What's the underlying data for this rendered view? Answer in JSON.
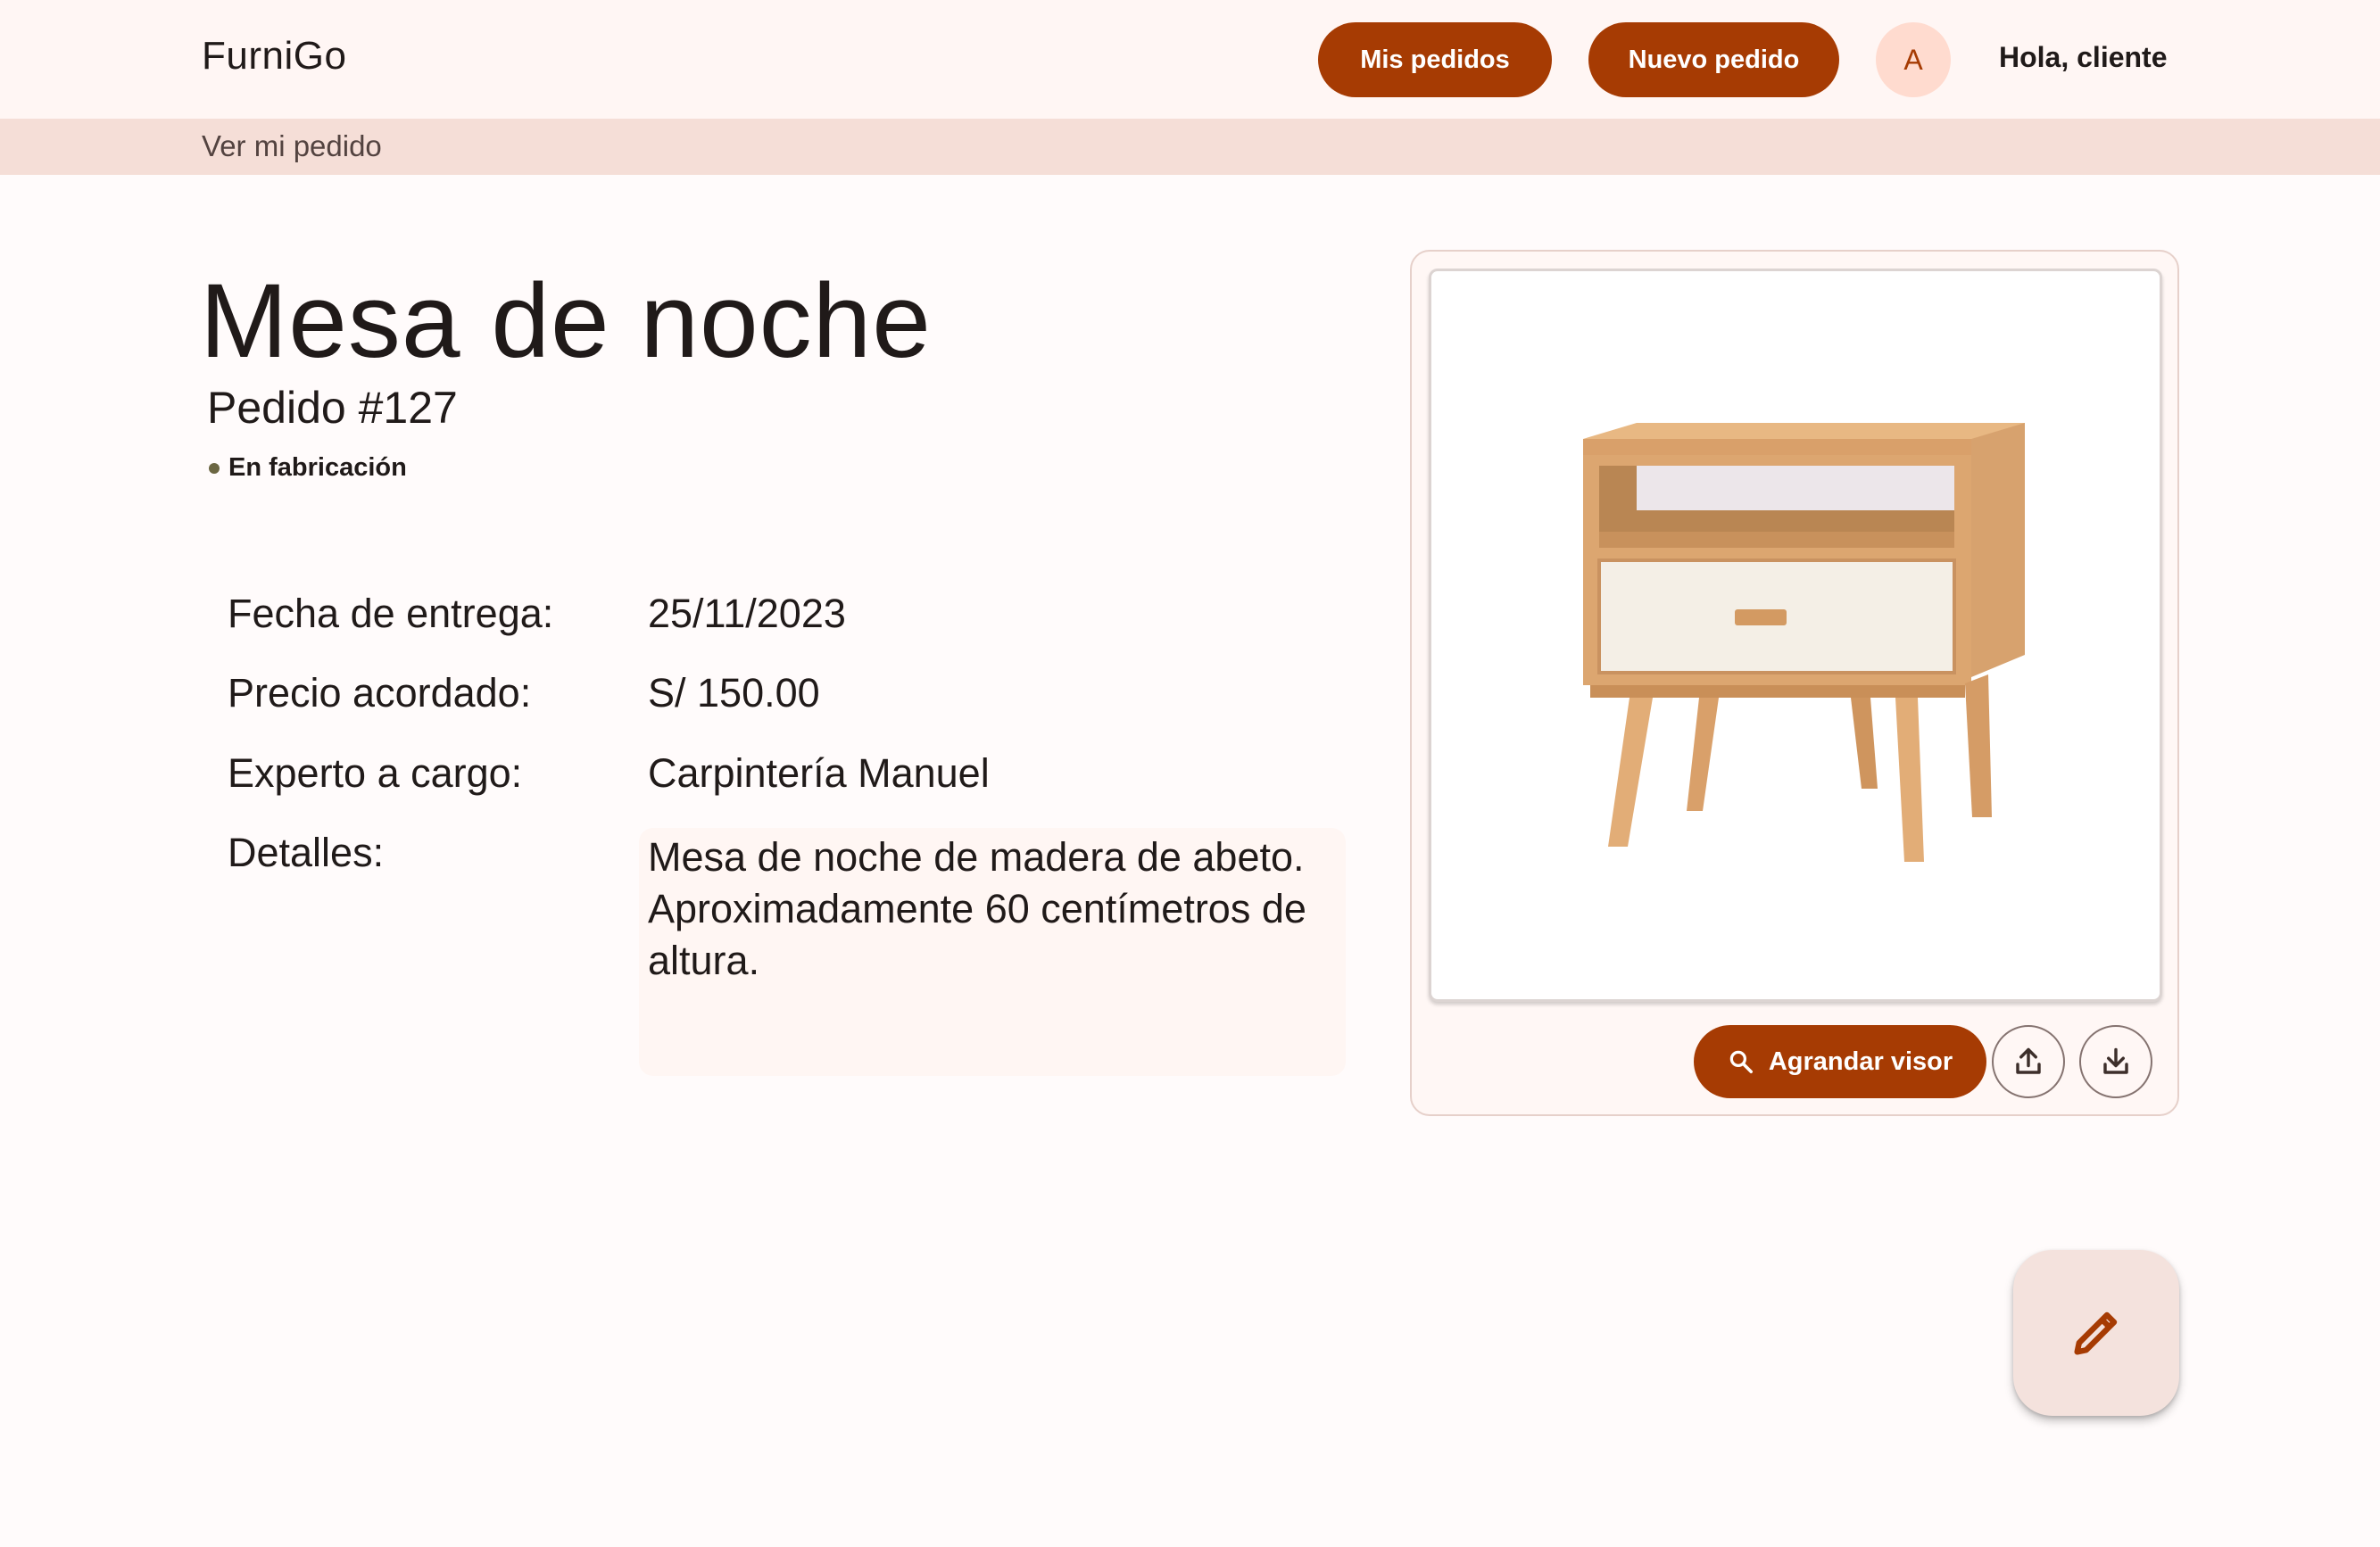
{
  "header": {
    "brand": "FurniGo",
    "nav": {
      "orders_label": "Mis pedidos",
      "new_order_label": "Nuevo pedido"
    },
    "avatar_initial": "A",
    "greeting": "Hola, cliente"
  },
  "breadcrumb": {
    "current": "Ver mi pedido"
  },
  "order": {
    "title": "Mesa de noche",
    "number": "Pedido #127",
    "status": "En fabricación",
    "details": {
      "delivery_label": "Fecha de entrega:",
      "delivery_value": "25/11/2023",
      "price_label": "Precio acordado:",
      "price_value": "S/ 150.00",
      "expert_label": "Experto a cargo:",
      "expert_value": "Carpintería Manuel",
      "notes_label": "Detalles:",
      "notes_value": "Mesa de noche de madera de abeto. Aproximadamente 60 centímetros de altura."
    }
  },
  "viewer": {
    "enlarge_label": "Agrandar visor",
    "upload_icon": "upload-icon",
    "download_icon": "download-icon",
    "search_icon": "search-icon"
  },
  "fab": {
    "icon": "pencil-icon"
  },
  "colors": {
    "primary": "#a63b03",
    "topbar_bg": "#fff6f4",
    "breadcrumb_bg": "#f5ded7",
    "avatar_bg": "#ffdbcf",
    "fab_bg": "#f4e2dd",
    "status_dot": "#6b6642"
  }
}
